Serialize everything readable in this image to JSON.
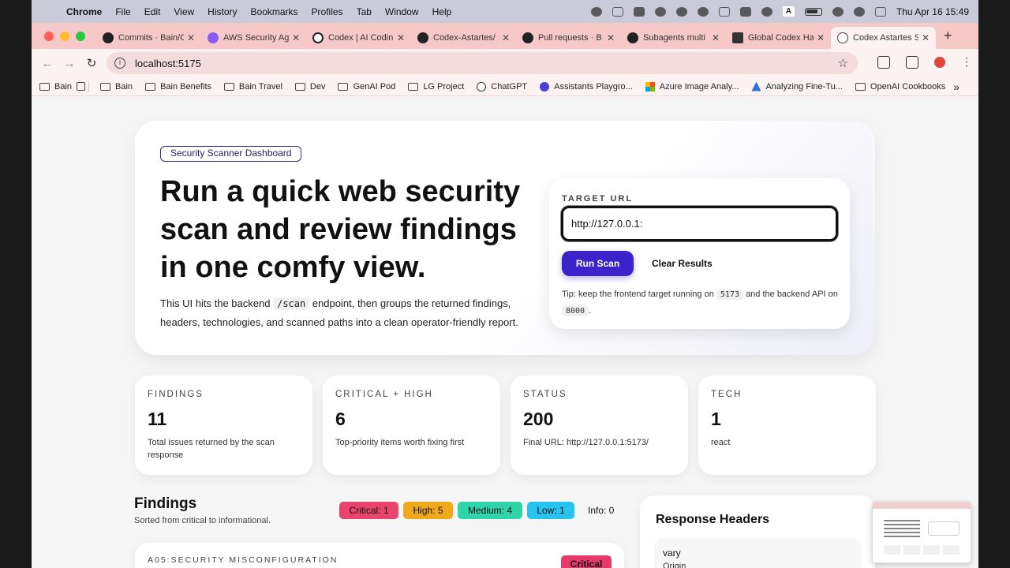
{
  "menubar": {
    "app": "Chrome",
    "items": [
      "File",
      "Edit",
      "View",
      "History",
      "Bookmarks",
      "Profiles",
      "Tab",
      "Window",
      "Help"
    ],
    "input_source": "A",
    "clock": "Thu Apr 16  15:49"
  },
  "tabs": [
    {
      "label": "Commits · Bain/C",
      "icon": "github-icon"
    },
    {
      "label": "AWS Security Ag",
      "icon": "aws-icon"
    },
    {
      "label": "Codex | AI Codin",
      "icon": "codex-icon"
    },
    {
      "label": "Codex-Astartes/",
      "icon": "github-icon"
    },
    {
      "label": "Pull requests · B",
      "icon": "github-icon"
    },
    {
      "label": "Subagents multi",
      "icon": "github-icon"
    },
    {
      "label": "Global Codex Ha",
      "icon": "global-icon"
    },
    {
      "label": "Codex Astartes S",
      "icon": "globe-icon",
      "active": true
    }
  ],
  "address": {
    "url": "localhost:5175"
  },
  "bookmarks": [
    {
      "label": "Bain",
      "type": "folder"
    },
    {
      "label": "Bain",
      "type": "folder"
    },
    {
      "label": "Bain Benefits",
      "type": "folder"
    },
    {
      "label": "Bain Travel",
      "type": "folder"
    },
    {
      "label": "Dev",
      "type": "folder"
    },
    {
      "label": "GenAI Pod",
      "type": "folder"
    },
    {
      "label": "LG Project",
      "type": "folder"
    },
    {
      "label": "ChatGPT",
      "type": "site"
    },
    {
      "label": "Assistants Playgro...",
      "type": "site"
    },
    {
      "label": "Azure Image Analy...",
      "type": "site"
    },
    {
      "label": "Analyzing Fine-Tu...",
      "type": "site"
    },
    {
      "label": "OpenAI Cookbooks",
      "type": "folder"
    }
  ],
  "hero": {
    "pill": "Security Scanner Dashboard",
    "headline": "Run a quick web security scan and review findings in one comfy view.",
    "sub_before": "This UI hits the backend",
    "sub_code": "/scan",
    "sub_after": "endpoint, then groups the returned findings, headers, technologies, and scanned paths into a clean operator-friendly report."
  },
  "scan": {
    "label": "TARGET URL",
    "value": "http://127.0.0.1:",
    "run_label": "Run Scan",
    "clear_label": "Clear Results",
    "tip_1": "Tip: keep the frontend target running on",
    "tip_port_1": "5173",
    "tip_2": "and the backend API on",
    "tip_port_2": "8000",
    "tip_3": "."
  },
  "stats": [
    {
      "label": "FINDINGS",
      "value": "11",
      "desc": "Total issues returned by the scan response"
    },
    {
      "label": "CRITICAL + HIGH",
      "value": "6",
      "desc": "Top-priority items worth fixing first"
    },
    {
      "label": "STATUS",
      "value": "200",
      "desc": "Final URL: http://127.0.0.1:5173/"
    },
    {
      "label": "TECH",
      "value": "1",
      "desc": "react"
    }
  ],
  "findings": {
    "title": "Findings",
    "subtitle": "Sorted from critical to informational.",
    "severity": {
      "critical": "Critical: 1",
      "high": "High: 5",
      "medium": "Medium: 4",
      "low": "Low: 1",
      "info": "Info: 0"
    },
    "first": {
      "category": "A05:SECURITY MISCONFIGURATION",
      "badge": "Critical"
    }
  },
  "headers": {
    "title": "Response Headers",
    "first_name": "vary",
    "first_value": "Origin"
  },
  "colors": {
    "accent": "#3a23c9",
    "critical": "#e8456e",
    "high": "#f0a81c",
    "medium": "#2fd4a8",
    "low": "#27c3ee"
  }
}
